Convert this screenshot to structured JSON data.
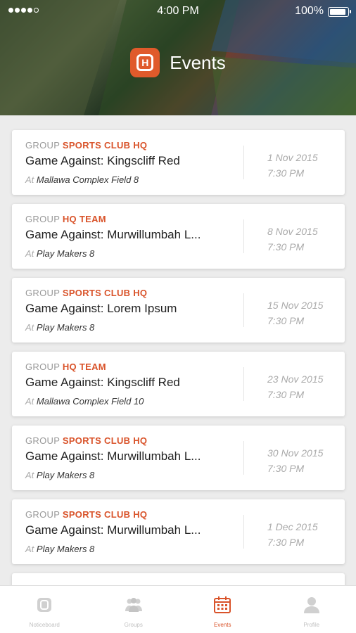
{
  "status_bar": {
    "time": "4:00 PM",
    "battery": "100%",
    "battery_level": 1.0
  },
  "header": {
    "title": "Events",
    "logo_letter": "H"
  },
  "events": [
    {
      "group_prefix": "GROUP",
      "group": "SPORTS CLUB HQ",
      "name": "Game Against: Kingscliff Red",
      "at": "At",
      "venue": "Mallawa Complex Field 8",
      "date": "1 Nov 2015",
      "time": "7:30 PM"
    },
    {
      "group_prefix": "GROUP",
      "group": "HQ TEAM",
      "name": "Game Against: Murwillumbah L...",
      "at": "At",
      "venue": "Play Makers 8",
      "date": "8 Nov 2015",
      "time": "7:30 PM"
    },
    {
      "group_prefix": "GROUP",
      "group": "SPORTS CLUB HQ",
      "name": "Game Against: Lorem Ipsum",
      "at": "At",
      "venue": "Play Makers 8",
      "date": "15 Nov 2015",
      "time": "7:30 PM"
    },
    {
      "group_prefix": "GROUP",
      "group": "HQ TEAM",
      "name": "Game Against: Kingscliff Red",
      "at": "At",
      "venue": "Mallawa Complex Field 10",
      "date": "23 Nov 2015",
      "time": "7:30 PM"
    },
    {
      "group_prefix": "GROUP",
      "group": "SPORTS CLUB HQ",
      "name": "Game Against: Murwillumbah L...",
      "at": "At",
      "venue": "Play Makers 8",
      "date": "30 Nov 2015",
      "time": "7:30 PM"
    },
    {
      "group_prefix": "GROUP",
      "group": "SPORTS CLUB HQ",
      "name": "Game Against: Murwillumbah L...",
      "at": "At",
      "venue": "Play Makers 8",
      "date": "1 Dec 2015",
      "time": "7:30 PM"
    }
  ],
  "tabs": [
    {
      "label": "Noticeboard",
      "icon": "logo-icon",
      "active": false
    },
    {
      "label": "Groups",
      "icon": "group-icon",
      "active": false
    },
    {
      "label": "Events",
      "icon": "calendar-icon",
      "active": true
    },
    {
      "label": "Profile",
      "icon": "user-icon",
      "active": false
    }
  ],
  "colors": {
    "accent": "#d9532a",
    "logo": "#e05a2b",
    "tab_inactive": "#c8c8c8"
  }
}
